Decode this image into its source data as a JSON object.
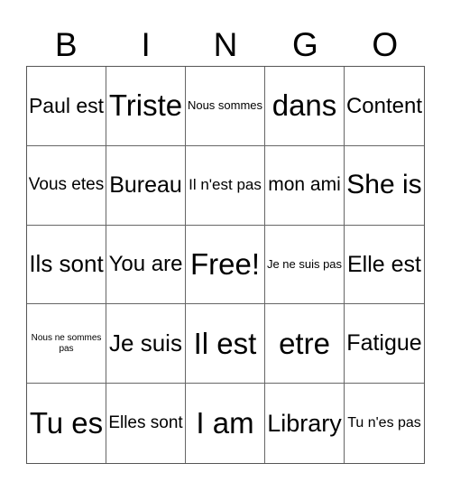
{
  "header": {
    "letters": [
      "B",
      "I",
      "N",
      "G",
      "O"
    ]
  },
  "board": {
    "cells": [
      [
        "Paul est",
        "Triste",
        "Nous sommes",
        "dans",
        "Content"
      ],
      [
        "Vous etes",
        "Bureau",
        "Il n'est pas",
        "mon ami",
        "She is"
      ],
      [
        "Ils sont",
        "You are",
        "Free!",
        "Je ne suis pas",
        "Elle est"
      ],
      [
        "Nous ne sommes pas",
        "Je suis",
        "Il est",
        "etre",
        "Fatigue"
      ],
      [
        "Tu es",
        "Elles sont",
        "I am",
        "Library",
        "Tu n'es pas"
      ]
    ],
    "free_space": {
      "row": 2,
      "col": 2,
      "label": "Free!"
    }
  }
}
